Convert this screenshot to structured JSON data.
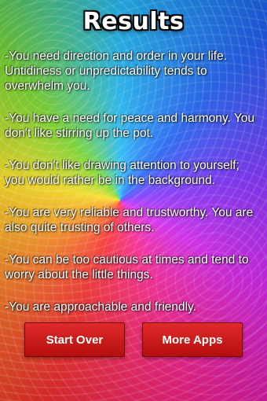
{
  "title": "Results",
  "results": [
    "-You need direction and order in your life. Untidiness or unpredictability tends to overwhelm you.",
    "-You have a need for peace and harmony. You don't like stirring up the pot.",
    "-You don't like drawing attention to yourself; you would rather be in the background.",
    "-You are very reliable and trustworthy. You are also quite trusting of others.",
    "-You can be too cautious at times and tend to worry about the little things.",
    "-You are approachable and friendly."
  ],
  "buttons": {
    "start_over": "Start Over",
    "more_apps": "More Apps"
  },
  "colors": {
    "button_red": "#c81a1a",
    "text": "#ffffff"
  }
}
